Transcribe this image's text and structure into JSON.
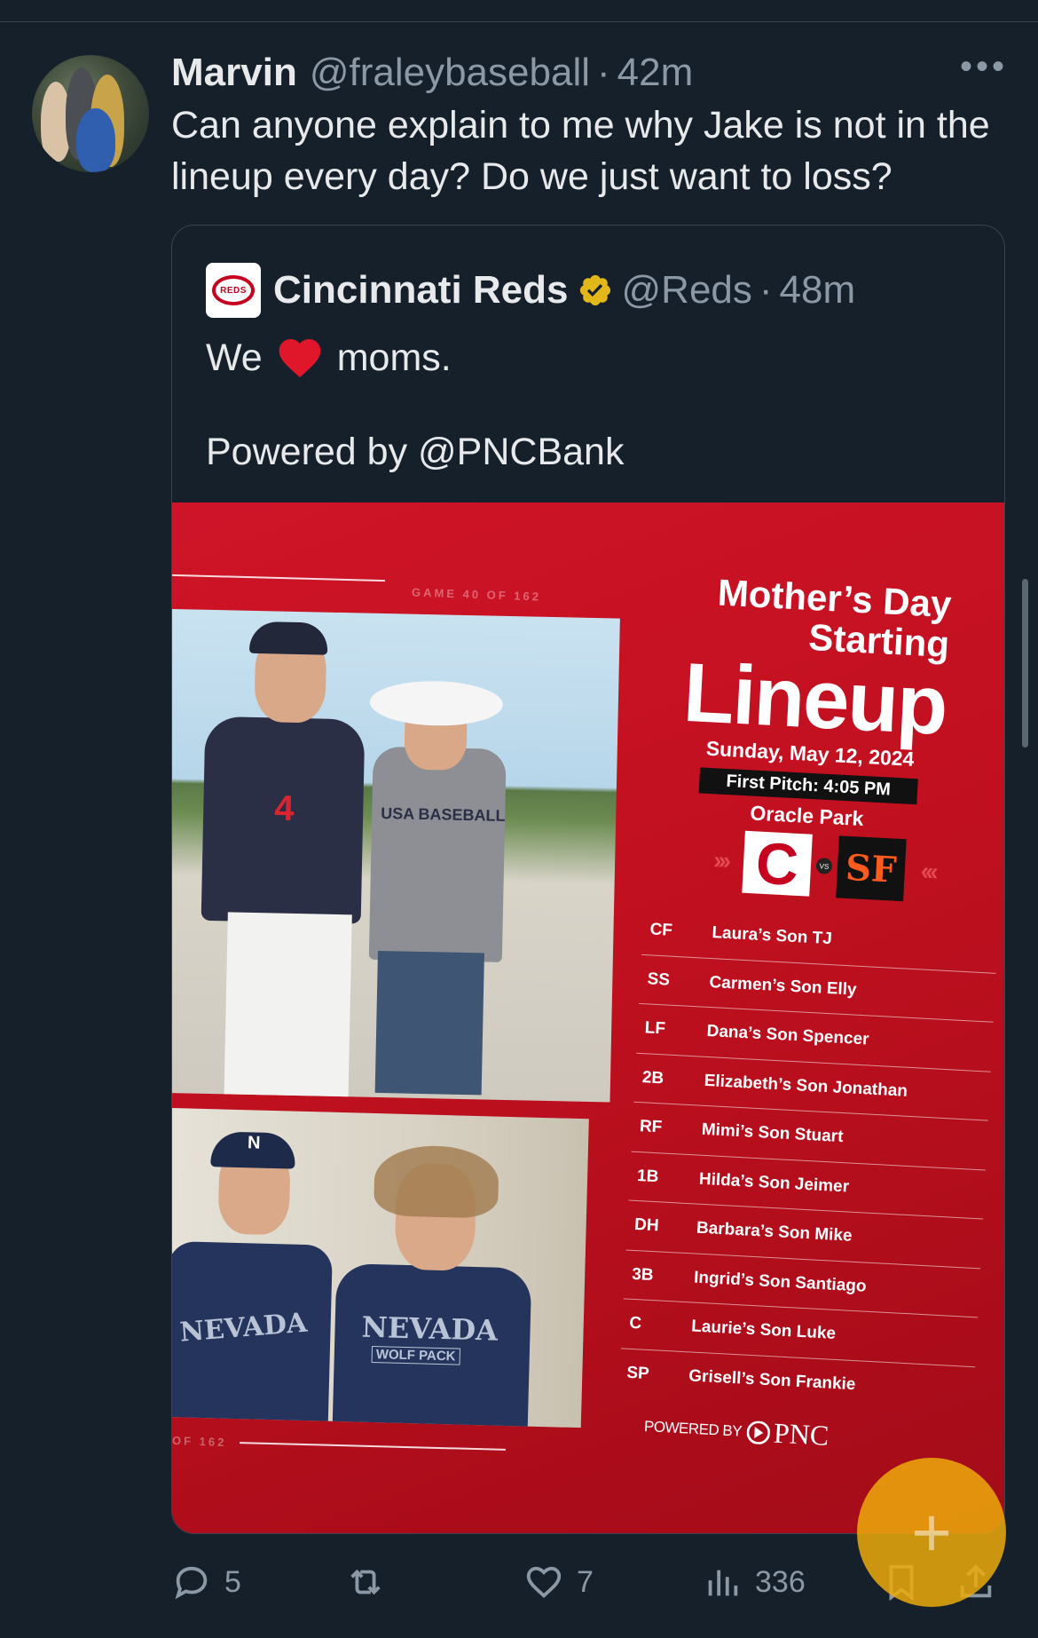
{
  "tweet": {
    "author_name": "Marvin",
    "author_handle": "@fraleybaseball",
    "separator": "·",
    "time": "42m",
    "text": "Can anyone explain to me why Jake is not in the lineup every day? Do we just want to loss?",
    "more_icon": "ellipsis-icon"
  },
  "quote": {
    "author_name": "Cincinnati Reds",
    "author_handle": "@Reds",
    "separator": "·",
    "time": "48m",
    "verified_color": "#e2b719",
    "logo_text": "REDS",
    "text_line1_before": "We",
    "text_line1_emoji": "❤️",
    "text_line1_after": "moms.",
    "text_line2": "Powered by @PNCBank"
  },
  "graphic": {
    "game_label_top": "GAME 40 OF 162",
    "game_label_bottom": "OF 162",
    "title_line1": "Mother’s Day",
    "title_line2": "Starting",
    "title_line3": "Lineup",
    "date": "Sunday, May 12, 2024",
    "first_pitch": "First Pitch: 4:05 PM",
    "park": "Oracle Park",
    "home_team_logo": "C",
    "away_team_logo": "SF",
    "vs_label": "VS",
    "lineup": [
      {
        "pos": "CF",
        "name": "Laura’s Son TJ"
      },
      {
        "pos": "SS",
        "name": "Carmen’s Son Elly"
      },
      {
        "pos": "LF",
        "name": "Dana’s Son Spencer"
      },
      {
        "pos": "2B",
        "name": "Elizabeth’s Son Jonathan"
      },
      {
        "pos": "RF",
        "name": "Mimi’s Son Stuart"
      },
      {
        "pos": "1B",
        "name": "Hilda’s Son Jeimer"
      },
      {
        "pos": "DH",
        "name": "Barbara’s Son Mike"
      },
      {
        "pos": "3B",
        "name": "Ingrid’s Son Santiago"
      },
      {
        "pos": "C",
        "name": "Laurie’s Son Luke"
      },
      {
        "pos": "SP",
        "name": "Grisell’s Son Frankie"
      }
    ],
    "powered_by": "POWERED BY",
    "sponsor": "PNC",
    "photo1_jersey_number": "4",
    "photo1_shirt_text": "USA BASEBALL",
    "photo2_shirt_left": "NEVADA",
    "photo2_shirt_right": "NEVADA",
    "photo2_shirt_sub": "WOLF PACK",
    "photo2_cap_letter": "N"
  },
  "actions": {
    "reply_count": "5",
    "like_count": "7",
    "views_count": "336",
    "reply_icon": "reply-icon",
    "retweet_icon": "retweet-icon",
    "like_icon": "heart-icon",
    "views_icon": "views-icon",
    "bookmark_icon": "bookmark-icon",
    "share_icon": "share-icon"
  },
  "fab": {
    "label": "+",
    "color": "#ecaa0c"
  }
}
